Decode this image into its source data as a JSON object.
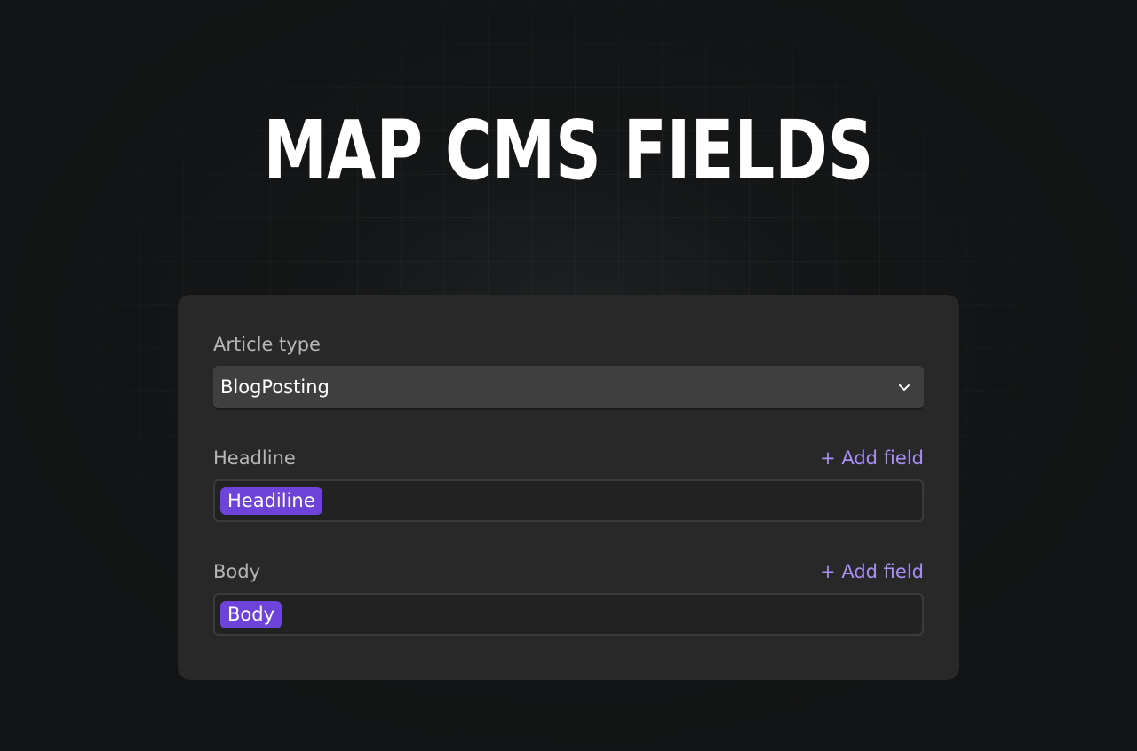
{
  "title": "MAP CMS FIELDS",
  "article_type": {
    "label": "Article type",
    "selected": "BlogPosting",
    "icon": "chevron-down-icon"
  },
  "headline": {
    "label": "Headline",
    "add_label": "+ Add field",
    "chips": [
      "Headiline"
    ]
  },
  "body": {
    "label": "Body",
    "add_label": "+ Add field",
    "chips": [
      "Body"
    ]
  },
  "colors": {
    "background": "#141617",
    "card": "#282828",
    "accent": "#a98ef5",
    "chip": "#6e43d9"
  }
}
